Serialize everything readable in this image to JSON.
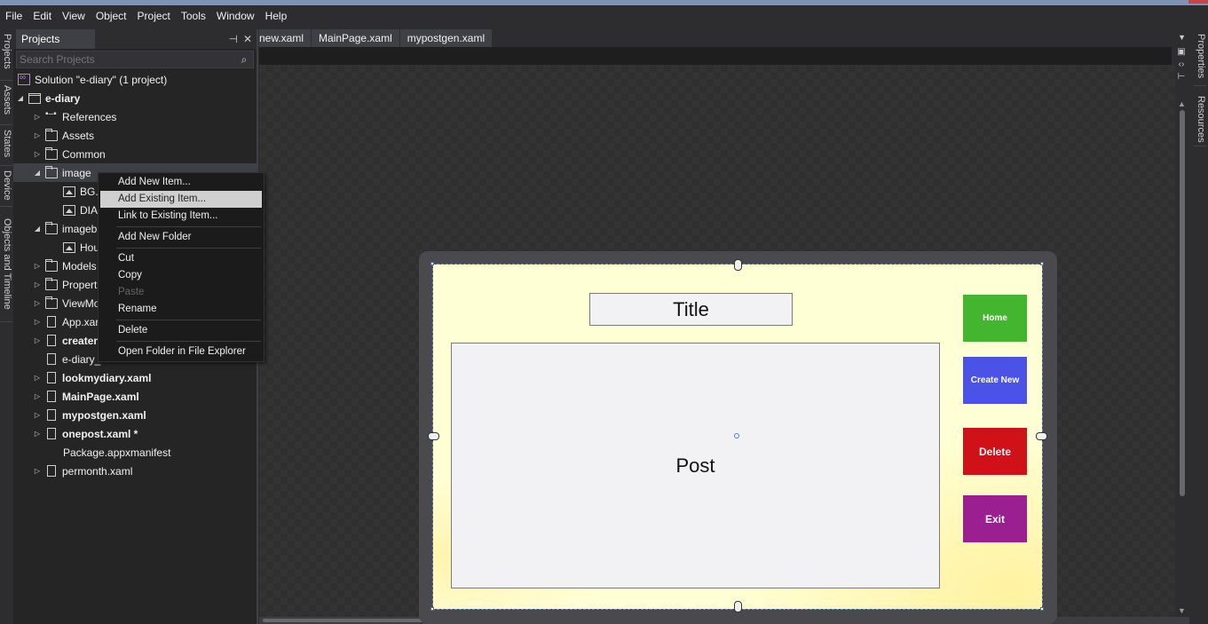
{
  "menubar": {
    "items": [
      "File",
      "Edit",
      "View",
      "Object",
      "Project",
      "Tools",
      "Window",
      "Help"
    ]
  },
  "left_vertical_tabs": [
    "Projects",
    "Assets",
    "States",
    "Device",
    "Objects and Timeline"
  ],
  "right_vertical_tabs": [
    "Properties",
    "Resources"
  ],
  "projects_panel": {
    "title": "Projects",
    "search_placeholder": "Search Projects",
    "tree": [
      {
        "label": "Solution \"e-diary\" (1 project)",
        "icon": "solution-icon",
        "bold": false
      },
      {
        "label": "e-diary",
        "icon": "project-icon",
        "bold": true,
        "expanded": true
      },
      {
        "label": "References",
        "icon": "references-icon",
        "bold": false,
        "collapsed": true
      },
      {
        "label": "Assets",
        "icon": "folder-icon",
        "bold": false,
        "collapsed": true
      },
      {
        "label": "Common",
        "icon": "folder-icon",
        "bold": false,
        "collapsed": true
      },
      {
        "label": "image",
        "icon": "folder-open-icon",
        "bold": false,
        "expanded": true,
        "selected": true
      },
      {
        "label": "BG.",
        "icon": "image-file-icon",
        "bold": false
      },
      {
        "label": "DIA",
        "icon": "image-file-icon",
        "bold": false
      },
      {
        "label": "imageb",
        "icon": "folder-open-icon",
        "bold": false,
        "expanded": true
      },
      {
        "label": "Hou",
        "icon": "image-file-icon",
        "bold": false
      },
      {
        "label": "Models",
        "icon": "folder-icon",
        "bold": false,
        "collapsed": true
      },
      {
        "label": "Propert",
        "icon": "folder-icon",
        "bold": false,
        "collapsed": true
      },
      {
        "label": "ViewMo",
        "icon": "folder-icon",
        "bold": false,
        "collapsed": true
      },
      {
        "label": "App.xar",
        "icon": "xaml-file-icon",
        "bold": false,
        "collapsed": true
      },
      {
        "label": "createn",
        "icon": "xaml-file-icon",
        "bold": true,
        "collapsed": true
      },
      {
        "label": "e-diary_",
        "icon": "file-icon",
        "bold": false
      },
      {
        "label": "lookmydiary.xaml",
        "icon": "xaml-file-icon",
        "bold": true,
        "collapsed": true
      },
      {
        "label": "MainPage.xaml",
        "icon": "xaml-file-icon",
        "bold": true,
        "collapsed": true
      },
      {
        "label": "mypostgen.xaml",
        "icon": "xaml-file-icon",
        "bold": true,
        "collapsed": true
      },
      {
        "label": "onepost.xaml *",
        "icon": "xaml-file-icon",
        "bold": true,
        "collapsed": true
      },
      {
        "label": "Package.appxmanifest",
        "icon": "manifest-icon",
        "bold": false
      },
      {
        "label": "permonth.xaml",
        "icon": "xaml-file-icon",
        "bold": false,
        "collapsed": true
      }
    ]
  },
  "context_menu": {
    "items": [
      {
        "label": "Add New Item...",
        "state": "normal"
      },
      {
        "label": "Add Existing Item...",
        "state": "highlight"
      },
      {
        "label": "Link to Existing Item...",
        "state": "normal"
      },
      {
        "separator": true
      },
      {
        "label": "Add New Folder",
        "state": "normal"
      },
      {
        "separator": true
      },
      {
        "label": "Cut",
        "state": "normal"
      },
      {
        "label": "Copy",
        "state": "normal"
      },
      {
        "label": "Paste",
        "state": "disabled"
      },
      {
        "label": "Rename",
        "state": "normal"
      },
      {
        "separator": true
      },
      {
        "label": "Delete",
        "state": "normal"
      },
      {
        "separator": true
      },
      {
        "label": "Open Folder in File Explorer",
        "state": "normal"
      }
    ]
  },
  "document_tabs": [
    "new.xaml",
    "MainPage.xaml",
    "mypostgen.xaml"
  ],
  "design_page": {
    "title_text": "Title",
    "post_text": "Post",
    "buttons": [
      {
        "label": "Home",
        "color": "#44b52f"
      },
      {
        "label": "Create New",
        "color": "#4a52e8"
      },
      {
        "label": "Delete",
        "color": "#d01118"
      },
      {
        "label": "Exit",
        "color": "#9b1f91"
      }
    ]
  }
}
